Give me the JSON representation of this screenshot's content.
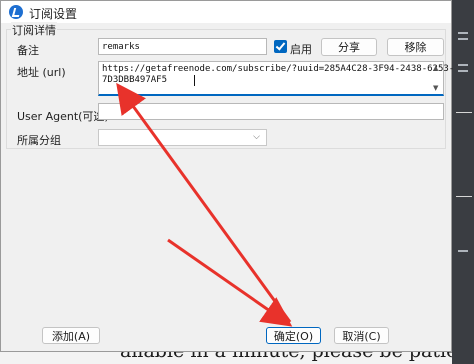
{
  "window": {
    "title": "订阅设置"
  },
  "group": {
    "legend": "订阅详情"
  },
  "fields": {
    "remark_label": "备注",
    "remark_value": "remarks",
    "enable_label": "启用",
    "share_label": "分享",
    "remove_label": "移除",
    "url_label": "地址 (url)",
    "url_line1": "https://getafreenode.com/subscribe/?uuid=285A4C28-3F94-2438-6253-",
    "url_line2": "7D3DBB497AF5",
    "ua_label": "User Agent(可选)",
    "ua_value": "",
    "group_label": "所属分组",
    "group_value": ""
  },
  "footer": {
    "add_label": "添加(A)",
    "ok_label": "确定(O)",
    "cancel_label": "取消(C)"
  },
  "background": {
    "text": "ailable in a minute, please be patient!"
  },
  "colors": {
    "accent": "#0067c0",
    "arrow": "#e8322b"
  },
  "state": {
    "enabled": true
  },
  "icons": {
    "app": "app-logo-icon",
    "checkbox": "checkmark-icon",
    "scroll_up": "scroll-up-icon",
    "scroll_down": "scroll-down-icon",
    "dropdown": "chevron-down-icon"
  }
}
